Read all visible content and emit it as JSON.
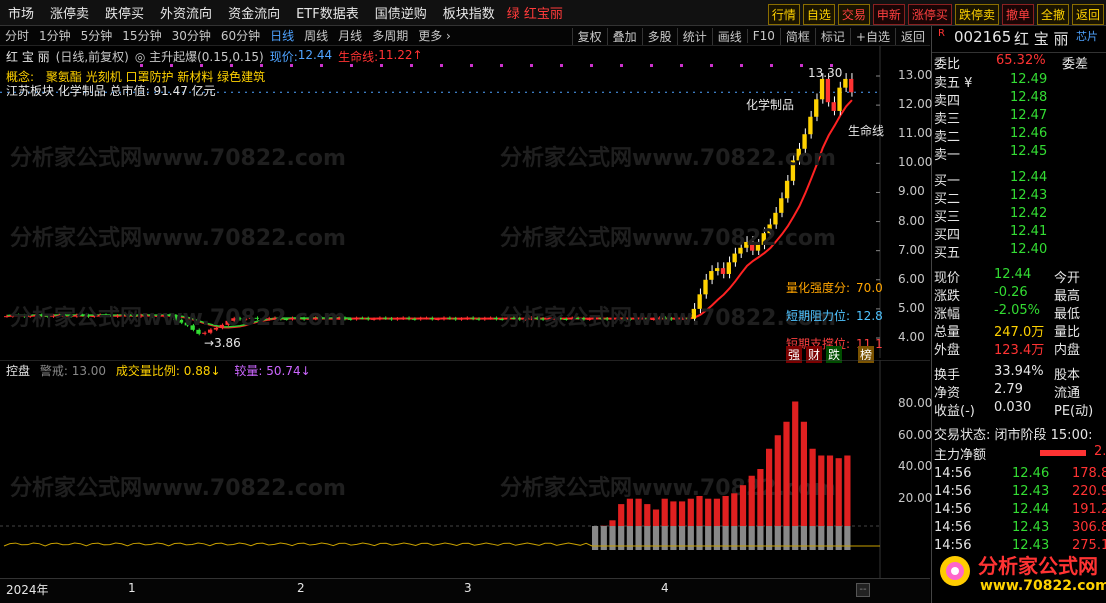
{
  "topmenu": [
    "市场",
    "涨停卖",
    "跌停买",
    "外资流向",
    "资金流向",
    "ETF数据表",
    "国债逆购",
    "板块指数"
  ],
  "stock_tag": "绿 红宝丽",
  "tabs": [
    "行情",
    "自选",
    "交易",
    "申新",
    "涨停买",
    "跌停卖",
    "撤单",
    "全撤",
    "返回"
  ],
  "periods": [
    "分时",
    "1分钟",
    "5分钟",
    "15分钟",
    "30分钟",
    "60分钟",
    "日线",
    "周线",
    "月线",
    "多周期",
    "更多 ›"
  ],
  "selected_period": "日线",
  "tools": [
    "复权",
    "叠加",
    "多股",
    "统计",
    "画线",
    "F10",
    "简框",
    "标记",
    "+自选",
    "返回"
  ],
  "info": {
    "name": "红 宝 丽",
    "mode": "(日线,前复权)",
    "indicator": "◎ 主升起爆(0.15,0.15)",
    "price_label": "现价:",
    "price": "12.44",
    "life_label": "生命线:",
    "life": "11.22↑"
  },
  "concept": {
    "label": "概念:",
    "items": "聚氨酯 光刻机 口罩防护 新材料 绿色建筑"
  },
  "sector": "江苏板块 化学制品 总市值: 91.47 亿元",
  "annotations": {
    "max": "13.30",
    "min": "3.86",
    "sector_label": "化学制品",
    "life_line": "生命线",
    "score_label": "量化强度分:",
    "score": "70.0",
    "resist_label": "短期阻力位:",
    "resist": "12.8",
    "support_label": "短期支撑位:",
    "support": "11.1",
    "tags": [
      "强",
      "财",
      "跌",
      "榜"
    ]
  },
  "price_axis": [
    "13.00",
    "12.00",
    "11.00",
    "10.00",
    "9.00",
    "8.00",
    "7.00",
    "6.00",
    "5.00",
    "4.00"
  ],
  "lower": {
    "title": "控盘",
    "warn": "警戒: 13.00",
    "ratio_label": "成交量比例:",
    "ratio": "0.88↓",
    "vol_label": "较量:",
    "vol": "50.74↓"
  },
  "lower_axis": [
    "80.00",
    "60.00",
    "40.00",
    "20.00"
  ],
  "xaxis": [
    "2024年",
    "1",
    "2",
    "3",
    "4"
  ],
  "right": {
    "code": "002165",
    "name": "红 宝 丽",
    "chip": "芯片",
    "weibi_label": "委比",
    "weibi": "65.32%",
    "weicha": "委差",
    "asks": [
      {
        "l": "卖五 ¥",
        "p": "12.49"
      },
      {
        "l": "卖四",
        "p": "12.48"
      },
      {
        "l": "卖三",
        "p": "12.47"
      },
      {
        "l": "卖二",
        "p": "12.46"
      },
      {
        "l": "卖一",
        "p": "12.45"
      }
    ],
    "bids": [
      {
        "l": "买一",
        "p": "12.44"
      },
      {
        "l": "买二",
        "p": "12.43"
      },
      {
        "l": "买三",
        "p": "12.42"
      },
      {
        "l": "买四",
        "p": "12.41"
      },
      {
        "l": "买五",
        "p": "12.40"
      }
    ],
    "stats": [
      {
        "l": "现价",
        "v": "12.44",
        "r": "今开"
      },
      {
        "l": "涨跌",
        "v": "-0.26",
        "r": "最高"
      },
      {
        "l": "涨幅",
        "v": "-2.05%",
        "r": "最低"
      },
      {
        "l": "总量",
        "v": "247.0万",
        "r": "量比"
      },
      {
        "l": "外盘",
        "v": "123.4万",
        "r": "内盘"
      }
    ],
    "stats2": [
      {
        "l": "换手",
        "v": "33.94%",
        "r": "股本"
      },
      {
        "l": "净资",
        "v": "2.79",
        "r": "流通"
      },
      {
        "l": "收益(-)",
        "v": "0.030",
        "r": "PE(动)"
      }
    ],
    "trade_state": "交易状态: 闭市阶段 15:00:",
    "mainflow": "主力净额",
    "mainflow_val": "2.",
    "ticks": [
      {
        "t": "14:56",
        "p": "12.46",
        "v": "178.8"
      },
      {
        "t": "14:56",
        "p": "12.43",
        "v": "220.9"
      },
      {
        "t": "14:56",
        "p": "12.44",
        "v": "191.2"
      },
      {
        "t": "14:56",
        "p": "12.43",
        "v": "306.8"
      },
      {
        "t": "14:56",
        "p": "12.43",
        "v": "275.1"
      }
    ],
    "logo": "分析家公式网",
    "logo_url": "www.70822.com"
  },
  "watermark": "分析家公式网www.70822.com"
}
